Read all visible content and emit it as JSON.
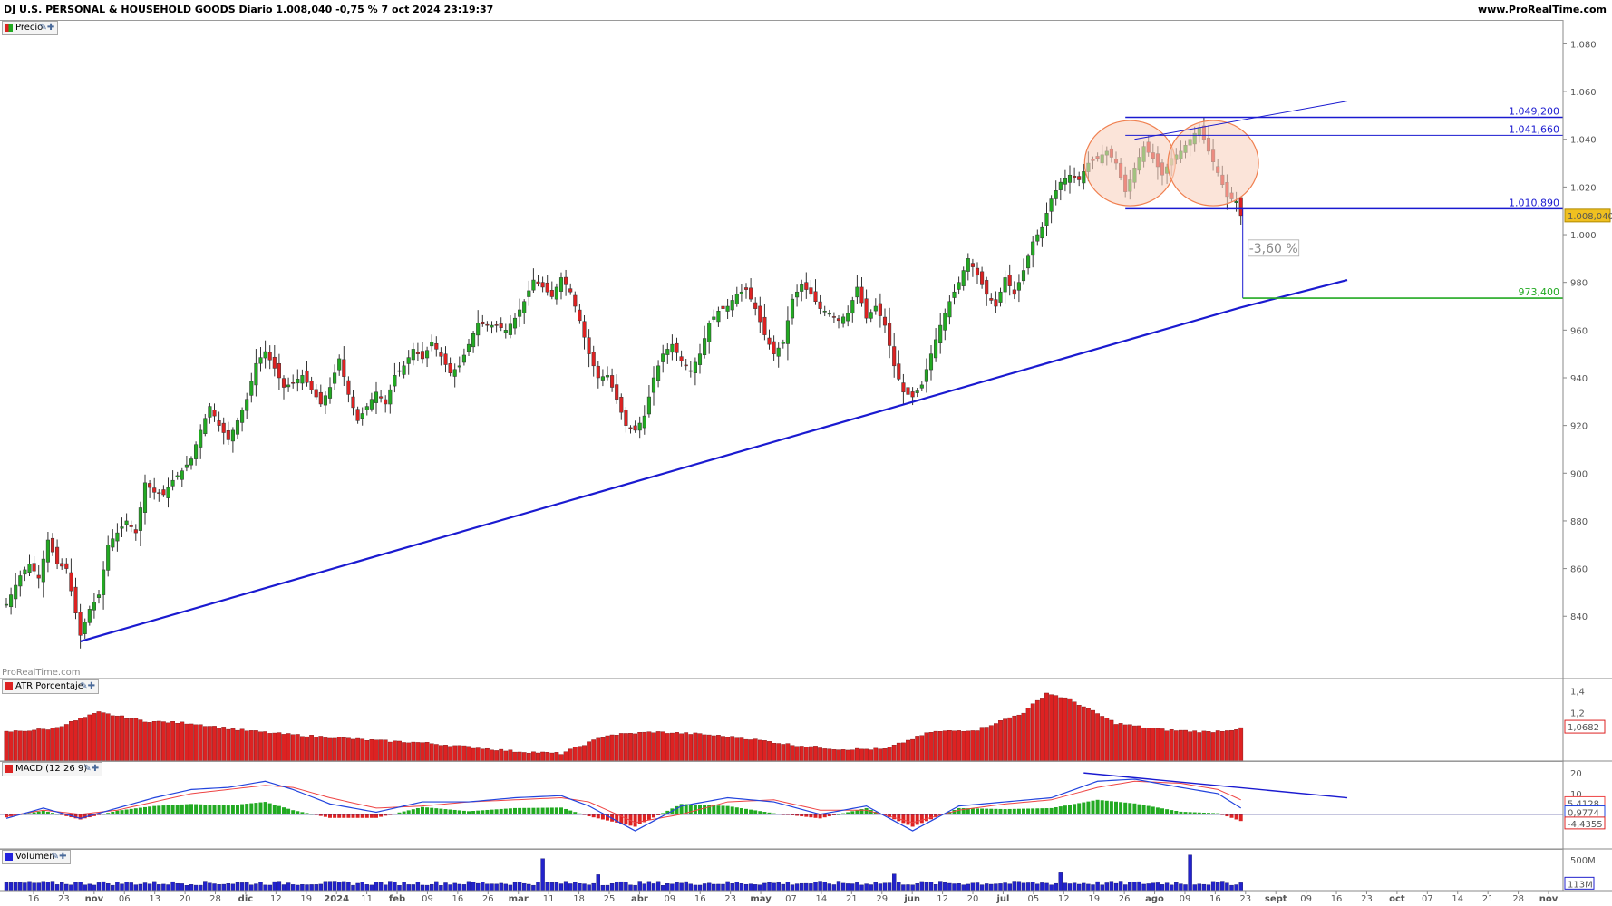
{
  "header": {
    "title": "DJ U.S. PERSONAL & HOUSEHOLD GOODS Diario 1.008,040 -0,75 % 7 oct 2024 23:19:37",
    "site": "www.ProRealTime.com"
  },
  "watermark": "ProRealTime.com",
  "icons": {
    "tools": "wrench-icon",
    "add": "plus-icon"
  },
  "colors": {
    "up": "#22aa22",
    "down": "#dd2222",
    "trend": "#1a1ad0",
    "ellipse_fill": "#f8d2c0",
    "ellipse_stroke": "#f08050",
    "target": "#22aa22",
    "macd": "#2244dd",
    "signal": "#ee4444"
  },
  "chart_data": [
    {
      "type": "candlestick",
      "legend": "Precio",
      "y_axis_ticks": [
        "1.080",
        "1.060",
        "1.040",
        "1.020",
        "1.000",
        "980",
        "960",
        "940",
        "920",
        "900",
        "880",
        "860",
        "840"
      ],
      "ylim": [
        823,
        1087
      ],
      "x_axis_labels": [
        "16",
        "23",
        "nov",
        "06",
        "13",
        "20",
        "28",
        "dic",
        "12",
        "19",
        "2024",
        "11",
        "feb",
        "09",
        "16",
        "26",
        "mar",
        "11",
        "18",
        "25",
        "abr",
        "09",
        "16",
        "23",
        "may",
        "07",
        "14",
        "21",
        "29",
        "jun",
        "12",
        "20",
        "jul",
        "05",
        "12",
        "19",
        "26",
        "ago",
        "09",
        "16",
        "23",
        "sept",
        "09",
        "16",
        "23",
        "oct",
        "07",
        "14",
        "21",
        "28",
        "nov"
      ],
      "close_path": [
        [
          0,
          845
        ],
        [
          3,
          857
        ],
        [
          5,
          862
        ],
        [
          7,
          856
        ],
        [
          9,
          872
        ],
        [
          11,
          862
        ],
        [
          13,
          860
        ],
        [
          16,
          832
        ],
        [
          18,
          843
        ],
        [
          20,
          849
        ],
        [
          22,
          870
        ],
        [
          24,
          875
        ],
        [
          26,
          880
        ],
        [
          28,
          875
        ],
        [
          30,
          896
        ],
        [
          32,
          892
        ],
        [
          34,
          891
        ],
        [
          36,
          897
        ],
        [
          38,
          901
        ],
        [
          40,
          906
        ],
        [
          42,
          918
        ],
        [
          44,
          928
        ],
        [
          46,
          920
        ],
        [
          48,
          914
        ],
        [
          50,
          922
        ],
        [
          52,
          931
        ],
        [
          54,
          946
        ],
        [
          56,
          951
        ],
        [
          58,
          944
        ],
        [
          60,
          936
        ],
        [
          62,
          938
        ],
        [
          64,
          941
        ],
        [
          66,
          935
        ],
        [
          68,
          929
        ],
        [
          70,
          936
        ],
        [
          72,
          948
        ],
        [
          74,
          933
        ],
        [
          76,
          922
        ],
        [
          78,
          928
        ],
        [
          80,
          934
        ],
        [
          82,
          929
        ],
        [
          84,
          941
        ],
        [
          86,
          945
        ],
        [
          88,
          952
        ],
        [
          90,
          948
        ],
        [
          92,
          955
        ],
        [
          94,
          949
        ],
        [
          96,
          942
        ],
        [
          98,
          945
        ],
        [
          100,
          954
        ],
        [
          102,
          963
        ],
        [
          104,
          962
        ],
        [
          106,
          962
        ],
        [
          108,
          960
        ],
        [
          110,
          965
        ],
        [
          112,
          972
        ],
        [
          114,
          981
        ],
        [
          116,
          978
        ],
        [
          118,
          974
        ],
        [
          120,
          982
        ],
        [
          122,
          976
        ],
        [
          124,
          964
        ],
        [
          126,
          950
        ],
        [
          128,
          940
        ],
        [
          130,
          941
        ],
        [
          132,
          931
        ],
        [
          134,
          920
        ],
        [
          136,
          918
        ],
        [
          138,
          924
        ],
        [
          140,
          940
        ],
        [
          142,
          950
        ],
        [
          144,
          954
        ],
        [
          146,
          947
        ],
        [
          148,
          943
        ],
        [
          150,
          950
        ],
        [
          152,
          963
        ],
        [
          154,
          968
        ],
        [
          156,
          970
        ],
        [
          158,
          975
        ],
        [
          160,
          977
        ],
        [
          162,
          969
        ],
        [
          164,
          958
        ],
        [
          166,
          950
        ],
        [
          168,
          955
        ],
        [
          170,
          973
        ],
        [
          172,
          979
        ],
        [
          174,
          975
        ],
        [
          176,
          969
        ],
        [
          178,
          967
        ],
        [
          180,
          964
        ],
        [
          182,
          967
        ],
        [
          184,
          978
        ],
        [
          186,
          965
        ],
        [
          188,
          970
        ],
        [
          190,
          962
        ],
        [
          192,
          945
        ],
        [
          194,
          934
        ],
        [
          196,
          932
        ],
        [
          198,
          937
        ],
        [
          200,
          950
        ],
        [
          202,
          962
        ],
        [
          204,
          972
        ],
        [
          206,
          980
        ],
        [
          208,
          990
        ],
        [
          210,
          983
        ],
        [
          212,
          975
        ],
        [
          214,
          970
        ],
        [
          216,
          982
        ],
        [
          218,
          975
        ],
        [
          220,
          985
        ],
        [
          222,
          997
        ],
        [
          224,
          1003
        ],
        [
          226,
          1015
        ],
        [
          228,
          1022
        ],
        [
          230,
          1025
        ],
        [
          232,
          1023
        ],
        [
          234,
          1030
        ],
        [
          236,
          1032
        ],
        [
          238,
          1035
        ],
        [
          240,
          1030
        ],
        [
          242,
          1018
        ],
        [
          244,
          1028
        ],
        [
          246,
          1037
        ],
        [
          248,
          1032
        ],
        [
          250,
          1025
        ],
        [
          252,
          1032
        ],
        [
          254,
          1035
        ],
        [
          256,
          1040
        ],
        [
          258,
          1045
        ],
        [
          260,
          1035
        ],
        [
          262,
          1026
        ],
        [
          264,
          1016
        ],
        [
          266,
          1014
        ],
        [
          267,
          1009
        ]
      ],
      "ohlc_last": {
        "open": 1015.6,
        "high": 1016.0,
        "low": 1004.2,
        "close": 1008.04
      },
      "levels": [
        {
          "label": "1.049,200",
          "value": 1049.2
        },
        {
          "label": "1.041,660",
          "value": 1041.66
        },
        {
          "label": "1.010,890",
          "value": 1010.89
        }
      ],
      "target": {
        "label": "973,400",
        "value": 973.4
      },
      "current_price_label": "1.008,040",
      "measure_label": "-3,60 %",
      "trendline": [
        [
          16,
          829.5
        ],
        [
          267,
          969.5
        ],
        [
          290,
          981
        ]
      ],
      "channel_line": [
        [
          244,
          1040
        ],
        [
          290,
          1056
        ]
      ]
    },
    {
      "type": "bar",
      "legend": "ATR Porcentaje",
      "y_axis_ticks": [
        "1,4",
        "1,2"
      ],
      "ylim": [
        0.75,
        1.48
      ],
      "current_label": "1,0682",
      "profile": [
        [
          0,
          1.02
        ],
        [
          10,
          1.05
        ],
        [
          20,
          1.2
        ],
        [
          30,
          1.12
        ],
        [
          40,
          1.1
        ],
        [
          50,
          1.04
        ],
        [
          60,
          1.0
        ],
        [
          70,
          0.97
        ],
        [
          80,
          0.94
        ],
        [
          90,
          0.92
        ],
        [
          100,
          0.88
        ],
        [
          110,
          0.84
        ],
        [
          120,
          0.82
        ],
        [
          130,
          0.99
        ],
        [
          140,
          1.02
        ],
        [
          150,
          1.0
        ],
        [
          160,
          0.96
        ],
        [
          170,
          0.9
        ],
        [
          180,
          0.86
        ],
        [
          190,
          0.86
        ],
        [
          200,
          1.02
        ],
        [
          210,
          1.04
        ],
        [
          220,
          1.2
        ],
        [
          225,
          1.38
        ],
        [
          230,
          1.32
        ],
        [
          240,
          1.1
        ],
        [
          250,
          1.04
        ],
        [
          260,
          1.02
        ],
        [
          267,
          1.05
        ]
      ]
    },
    {
      "type": "line",
      "legend": "MACD (12 26 9)",
      "y_axis_ticks": [
        "20",
        "10"
      ],
      "ylim": [
        -15,
        24
      ],
      "current_labels": [
        "5,4128",
        "0,9774",
        "-4,4355"
      ],
      "series_macd": [
        [
          0,
          -2
        ],
        [
          8,
          3
        ],
        [
          16,
          -2
        ],
        [
          24,
          3
        ],
        [
          32,
          8
        ],
        [
          40,
          12
        ],
        [
          48,
          13
        ],
        [
          56,
          16
        ],
        [
          62,
          12
        ],
        [
          70,
          5
        ],
        [
          80,
          1
        ],
        [
          90,
          6
        ],
        [
          100,
          6
        ],
        [
          110,
          8
        ],
        [
          120,
          9
        ],
        [
          126,
          4
        ],
        [
          136,
          -8
        ],
        [
          146,
          4
        ],
        [
          156,
          8
        ],
        [
          166,
          6
        ],
        [
          176,
          0
        ],
        [
          186,
          4
        ],
        [
          196,
          -8
        ],
        [
          206,
          4
        ],
        [
          216,
          6
        ],
        [
          226,
          8
        ],
        [
          236,
          16
        ],
        [
          244,
          17
        ],
        [
          254,
          13
        ],
        [
          262,
          10
        ],
        [
          267,
          3
        ]
      ],
      "series_signal": [
        [
          0,
          -1
        ],
        [
          8,
          2
        ],
        [
          16,
          0
        ],
        [
          24,
          2
        ],
        [
          32,
          6
        ],
        [
          40,
          10
        ],
        [
          48,
          12
        ],
        [
          56,
          14
        ],
        [
          62,
          13
        ],
        [
          70,
          8
        ],
        [
          80,
          3
        ],
        [
          90,
          4
        ],
        [
          100,
          6
        ],
        [
          110,
          7
        ],
        [
          120,
          8
        ],
        [
          126,
          6
        ],
        [
          136,
          -4
        ],
        [
          146,
          0
        ],
        [
          156,
          6
        ],
        [
          166,
          7
        ],
        [
          176,
          2
        ],
        [
          186,
          2
        ],
        [
          196,
          -4
        ],
        [
          206,
          2
        ],
        [
          216,
          5
        ],
        [
          226,
          7
        ],
        [
          236,
          13
        ],
        [
          244,
          16
        ],
        [
          254,
          15
        ],
        [
          262,
          12
        ],
        [
          267,
          7
        ]
      ],
      "divergence_line": [
        [
          233,
          20
        ],
        [
          290,
          8
        ]
      ]
    },
    {
      "type": "bar",
      "legend": "Volumen",
      "y_axis_ticks": [
        "500M"
      ],
      "ylim": [
        0,
        620
      ],
      "current_label": "113M",
      "spikes": [
        [
          116,
          520
        ],
        [
          256,
          580
        ],
        [
          228,
          290
        ],
        [
          128,
          260
        ],
        [
          192,
          270
        ]
      ]
    }
  ]
}
